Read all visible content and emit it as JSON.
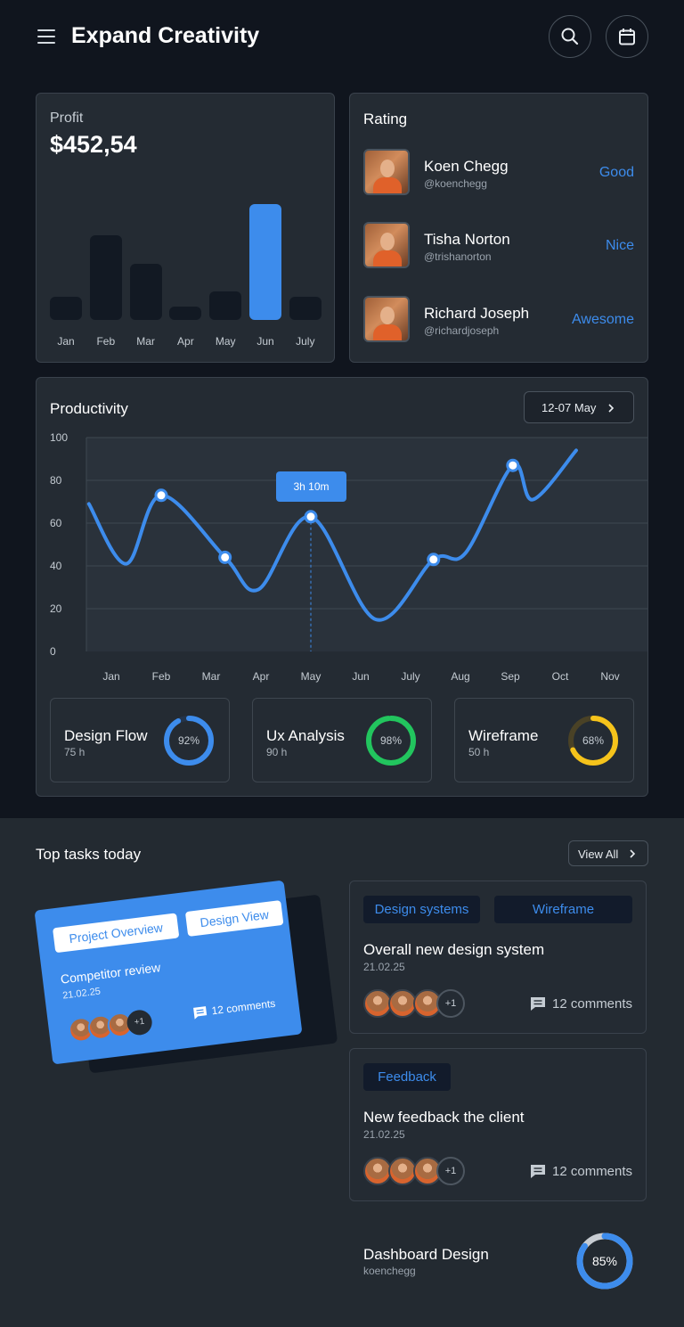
{
  "header": {
    "title": "Expand Creativity",
    "menu_icon": "hamburger-icon",
    "search_icon": "search-icon",
    "calendar_icon": "calendar-icon"
  },
  "profit": {
    "label": "Profit",
    "value": "$452,54",
    "months": [
      "Jan",
      "Feb",
      "Mar",
      "Apr",
      "May",
      "Jun",
      "July"
    ],
    "values": [
      26,
      95,
      63,
      15,
      32,
      130,
      26
    ],
    "active_index": 5
  },
  "rating": {
    "title": "Rating",
    "items": [
      {
        "name": "Koen Chegg",
        "handle": "@koenchegg",
        "rating": "Good"
      },
      {
        "name": "Tisha Norton",
        "handle": "@trishanorton",
        "rating": "Nice"
      },
      {
        "name": "Richard Joseph",
        "handle": "@richardjoseph",
        "rating": "Awesome"
      }
    ]
  },
  "productivity": {
    "title": "Productivity",
    "date_range": "12-07 May",
    "tooltip": "3h 10m",
    "stats": [
      {
        "name": "Design Flow",
        "hours": "75 h",
        "percent_label": "92%",
        "percent": 0.92,
        "color": "#3d8cec"
      },
      {
        "name": "Ux Analysis",
        "hours": "90 h",
        "percent_label": "98%",
        "percent": 0.98,
        "color": "#22c55e"
      },
      {
        "name": "Wireframe",
        "hours": "50 h",
        "percent_label": "68%",
        "percent": 0.68,
        "color": "#f5c31b"
      }
    ]
  },
  "chart_data": {
    "type": "line",
    "title": "Productivity",
    "categories": [
      "Jan",
      "Feb",
      "Mar",
      "Apr",
      "May",
      "Jun",
      "July",
      "Aug",
      "Sep",
      "Oct",
      "Nov"
    ],
    "yticks": [
      100,
      80,
      60,
      40,
      20,
      0
    ],
    "ylim": [
      0,
      100
    ],
    "grid": true,
    "series": [
      {
        "points": [
          [
            -0.45,
            69
          ],
          [
            0.3,
            41
          ],
          [
            1.0,
            73
          ],
          [
            2.28,
            44
          ],
          [
            2.95,
            29
          ],
          [
            4.0,
            63
          ],
          [
            5.3,
            15
          ],
          [
            6.46,
            43
          ],
          [
            7.1,
            46
          ],
          [
            8.05,
            87
          ],
          [
            8.45,
            71
          ],
          [
            9.32,
            94
          ]
        ]
      }
    ],
    "markers": [
      [
        1.0,
        73
      ],
      [
        2.28,
        44
      ],
      [
        4.0,
        63
      ],
      [
        6.46,
        43
      ],
      [
        8.05,
        87
      ]
    ],
    "highlight": {
      "x": 4.0,
      "y": 63,
      "label": "3h 10m"
    },
    "color": "#3d8cec"
  },
  "tasks": {
    "title": "Top tasks today",
    "view_all": "View All",
    "featured": {
      "tags": [
        "Project Overview",
        "Design View"
      ],
      "title": "Competitor review",
      "date": "21.02.25",
      "plus": "+1",
      "comments": "12 comments"
    },
    "items": [
      {
        "tags": [
          "Design systems",
          "Wireframe"
        ],
        "title": "Overall new design system",
        "date": "21.02.25",
        "plus": "+1",
        "comments": "12 comments"
      },
      {
        "tags": [
          "Feedback"
        ],
        "title": "New feedback the client",
        "date": "21.02.25",
        "plus": "+1",
        "comments": "12 comments"
      }
    ],
    "dashboard": {
      "title": "Dashboard Design",
      "user": "koenchegg",
      "percent_label": "85%",
      "percent": 0.85
    }
  },
  "colors": {
    "accent": "#3d8cec",
    "green": "#22c55e",
    "yellow": "#f5c31b",
    "bg_dark": "#10151e",
    "card": "#242b33"
  }
}
